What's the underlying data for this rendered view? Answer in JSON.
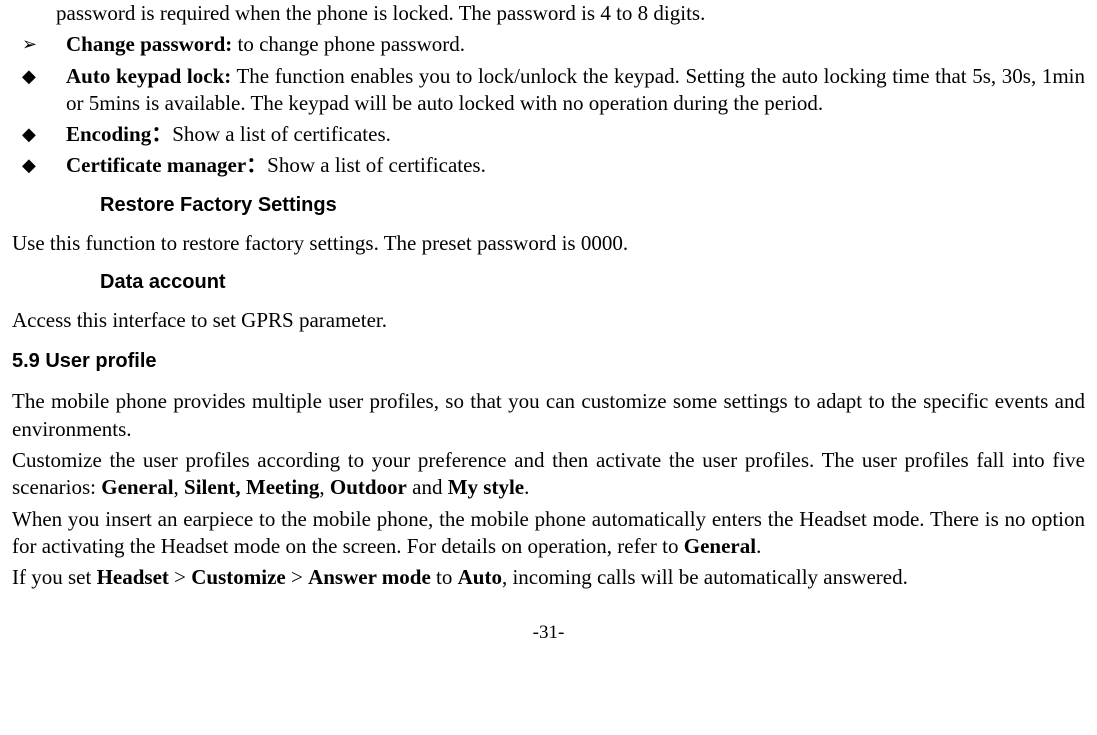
{
  "topLine": "password is required when the phone is locked. The password is 4 to 8 digits.",
  "bullets": [
    {
      "marker": "➢",
      "boldLabel": "Change password:",
      "text": " to change phone password."
    },
    {
      "marker": "◆",
      "boldLabel": "Auto keypad lock:",
      "text": " The function enables you to lock/unlock the keypad. Setting the auto locking time that 5s, 30s, 1min or 5mins is available. The keypad will be auto locked with no operation during the period."
    },
    {
      "marker": "◆",
      "boldLabel": "Encoding：",
      "text": "Show a list of certificates."
    },
    {
      "marker": "◆",
      "boldLabel": "Certificate manager：",
      "text": "Show a list of certificates."
    }
  ],
  "heading1": "Restore Factory Settings",
  "para1": "Use this function to restore factory settings. The preset password is 0000.",
  "heading2": "Data account",
  "para2": "Access this interface to set GPRS parameter.",
  "sectionNumber": "5.9    User profile",
  "para3a": "The mobile phone provides multiple user profiles, so that you can customize some settings to adapt to the specific events and environments.",
  "para3b_pre": "Customize the user profiles according to your preference and then activate the user profiles. The user profiles fall into five scenarios: ",
  "profiles": {
    "p1": "General",
    "sep1": ", ",
    "p2": "Silent, Meeting",
    "sep2": ", ",
    "p3": "Outdoor",
    "sep3": " and ",
    "p4": "My style",
    "end": "."
  },
  "para3c_pre": "When you insert an earpiece to the mobile phone, the mobile phone automatically enters the Headset mode. There is no option for activating the Headset mode on the screen. For details on operation, refer to ",
  "para3c_bold": "General",
  "para3c_post": ".",
  "para3d_pre": "If you set ",
  "para3d_b1": "Headset",
  "para3d_s1": " > ",
  "para3d_b2": "Customize",
  "para3d_s2": " > ",
  "para3d_b3": "Answer mode",
  "para3d_s3": " to ",
  "para3d_b4": "Auto",
  "para3d_post": ", incoming calls will be automatically answered.",
  "pageNumber": "-31-"
}
